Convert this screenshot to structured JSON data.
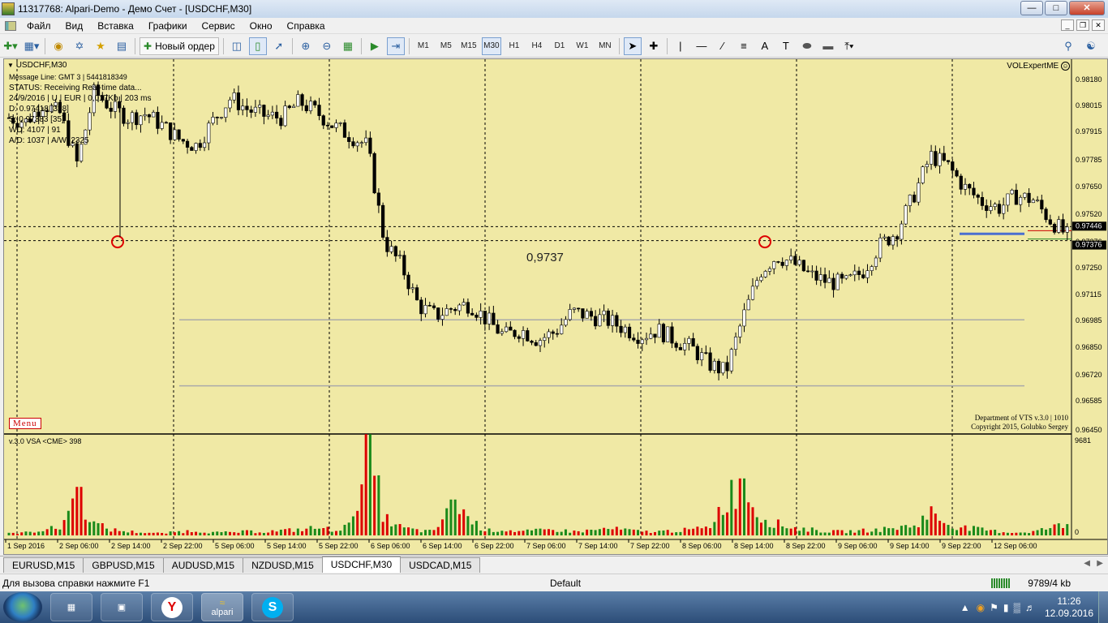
{
  "window": {
    "title": "11317768: Alpari-Demo - Демо Счет - [USDCHF,M30]"
  },
  "menu": {
    "items": [
      "Файл",
      "Вид",
      "Вставка",
      "Графики",
      "Сервис",
      "Окно",
      "Справка"
    ]
  },
  "toolbar": {
    "new_order_label": "Новый ордер",
    "periods": [
      "M1",
      "M5",
      "M15",
      "M30",
      "H1",
      "H4",
      "D1",
      "W1",
      "MN"
    ],
    "active_period": "M30"
  },
  "chart": {
    "symbol_label": "USDCHF,M30",
    "info_lines": [
      "Message Line: GMT 3 | 5441818349",
      "STATUS:  Receiving Real-time data...",
      "24/9/2016 | U | EUR | 0,017Kb | 203 ms",
      "D: 0.97418 [328]",
      "S: 0.97383 [35]",
      "WD: 4107 | 91",
      "A/D: 1037 | A/W: 2325"
    ],
    "expert_label": "VOLExpertME",
    "annotation_value": "0,9737",
    "menu_button": "Menu",
    "footer_line1": "Department of VTS  v.3.0 | 1010",
    "footer_line2": "Copyright 2015, Golubko Sergey",
    "price_axis": [
      "0.98180",
      "0.98015",
      "0.97915",
      "0.97785",
      "0.97650",
      "0.97520",
      "0.97376",
      "0.97250",
      "0.97115",
      "0.96985",
      "0.96850",
      "0.96720",
      "0.96585",
      "0.96450"
    ],
    "bid_tag": "0.97446",
    "ask_tag": "0.97376",
    "time_axis": [
      "1 Sep 2016",
      "2 Sep 06:00",
      "2 Sep 14:00",
      "2 Sep 22:00",
      "5 Sep 06:00",
      "5 Sep 14:00",
      "5 Sep 22:00",
      "6 Sep 06:00",
      "6 Sep 14:00",
      "6 Sep 22:00",
      "7 Sep 06:00",
      "7 Sep 14:00",
      "7 Sep 22:00",
      "8 Sep 06:00",
      "8 Sep 14:00",
      "8 Sep 22:00",
      "9 Sep 06:00",
      "9 Sep 14:00",
      "9 Sep 22:00",
      "12 Sep 06:00"
    ],
    "volume_label": "v.3.0 VSA <CME> 398",
    "volume_max": "9681",
    "volume_min": "0"
  },
  "chart_data": {
    "type": "candlestick",
    "symbol": "USDCHF",
    "timeframe": "M30",
    "ylim": [
      0.9645,
      0.9825
    ],
    "close_path": [
      0.9799,
      0.9797,
      0.9806,
      0.9801,
      0.9776,
      0.9812,
      0.9804,
      0.9799,
      0.9801,
      0.9795,
      0.9788,
      0.9785,
      0.9798,
      0.9809,
      0.9803,
      0.98,
      0.9799,
      0.9807,
      0.9802,
      0.9795,
      0.979,
      0.9785,
      0.9737,
      0.9725,
      0.9705,
      0.97,
      0.9704,
      0.9706,
      0.9698,
      0.969,
      0.9693,
      0.9688,
      0.9692,
      0.9702,
      0.97,
      0.9698,
      0.9694,
      0.969,
      0.9693,
      0.9688,
      0.9684,
      0.9676,
      0.9672,
      0.9699,
      0.9722,
      0.973,
      0.9726,
      0.972,
      0.9717,
      0.9716,
      0.9722,
      0.9735,
      0.9742,
      0.976,
      0.978,
      0.9775,
      0.9764,
      0.9757,
      0.9754,
      0.976,
      0.9758,
      0.9748,
      0.974
    ],
    "volume_heights": [
      2,
      3,
      6,
      8,
      44,
      12,
      6,
      4,
      3,
      2,
      4,
      5,
      3,
      3,
      4,
      4,
      5,
      6,
      8,
      6,
      10,
      96,
      18,
      8,
      5,
      4,
      42,
      16,
      5,
      6,
      4,
      5,
      6,
      4,
      5,
      7,
      6,
      4,
      4,
      5,
      6,
      8,
      38,
      56,
      20,
      12,
      8,
      6,
      4,
      4,
      5,
      6,
      8,
      10,
      24,
      12,
      8,
      6,
      4,
      3,
      4,
      8,
      12
    ],
    "horizontal_levels": [
      0.97446,
      0.97376,
      0.9698,
      0.9665
    ],
    "marked_lows": [
      0.9737,
      0.9737
    ]
  },
  "tabs": [
    "EURUSD,M15",
    "GBPUSD,M15",
    "AUDUSD,M15",
    "NZDUSD,M15",
    "USDCHF,M30",
    "USDCAD,M15"
  ],
  "active_tab": "USDCHF,M30",
  "status": {
    "help": "Для вызова справки нажмите F1",
    "profile": "Default",
    "traffic": "9789/4 kb"
  },
  "taskbar": {
    "apps": [
      "calculator",
      "computer",
      "yandex",
      "alpari",
      "skype"
    ],
    "alpari_label": "alpari",
    "time": "11:26",
    "date": "12.09.2016"
  }
}
